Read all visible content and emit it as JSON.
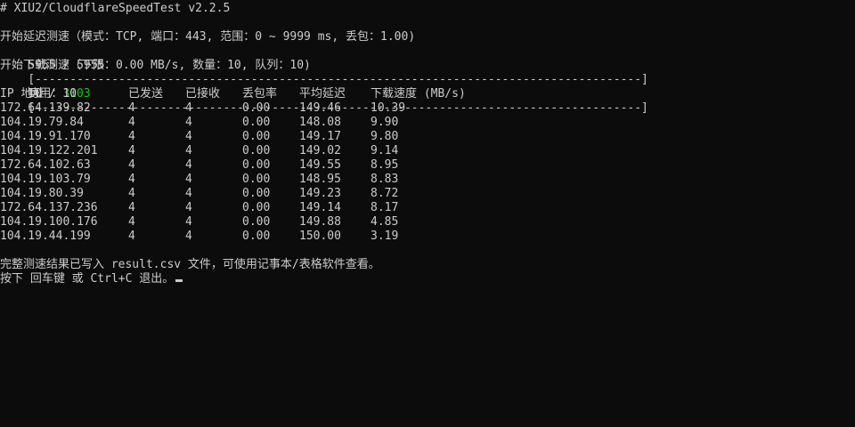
{
  "header": "# XIU2/CloudflareSpeedTest v2.2.5",
  "latency": {
    "start_line": "开始延迟测速（模式：TCP, 端口：443, 范围：0 ~ 9999 ms, 丢包：1.00)",
    "progress_count": "5955 / 5955",
    "progress_bar": "[---------------------------------------------------------------------------------------]",
    "available_label": "可用：",
    "available_value": "3103"
  },
  "download": {
    "start_line": "开始下载测速（下限：0.00 MB/s, 数量：10, 队列：10)",
    "progress_count": "10 / 10",
    "progress_bar": "[---------------------------------------------------------------------------------------]"
  },
  "table": {
    "headers": [
      "IP 地址",
      "已发送",
      "已接收",
      "丢包率",
      "平均延迟",
      "下载速度 (MB/s)"
    ],
    "rows": [
      [
        "172.64.139.82",
        "4",
        "4",
        "0.00",
        "149.46",
        "10.39"
      ],
      [
        "104.19.79.84",
        "4",
        "4",
        "0.00",
        "148.08",
        "9.90"
      ],
      [
        "104.19.91.170",
        "4",
        "4",
        "0.00",
        "149.17",
        "9.80"
      ],
      [
        "104.19.122.201",
        "4",
        "4",
        "0.00",
        "149.02",
        "9.14"
      ],
      [
        "172.64.102.63",
        "4",
        "4",
        "0.00",
        "149.55",
        "8.95"
      ],
      [
        "104.19.103.79",
        "4",
        "4",
        "0.00",
        "148.95",
        "8.83"
      ],
      [
        "104.19.80.39",
        "4",
        "4",
        "0.00",
        "149.23",
        "8.72"
      ],
      [
        "172.64.137.236",
        "4",
        "4",
        "0.00",
        "149.14",
        "8.17"
      ],
      [
        "104.19.100.176",
        "4",
        "4",
        "0.00",
        "149.88",
        "4.85"
      ],
      [
        "104.19.44.199",
        "4",
        "4",
        "0.00",
        "150.00",
        "3.19"
      ]
    ]
  },
  "footer": {
    "result_line": "完整测速结果已写入 result.csv 文件，可使用记事本/表格软件查看。",
    "exit_line": "按下 回车键 或 Ctrl+C 退出。"
  },
  "colors": {
    "background": "#0c0c0c",
    "foreground": "#cccccc",
    "available_value": "#16c60c"
  }
}
